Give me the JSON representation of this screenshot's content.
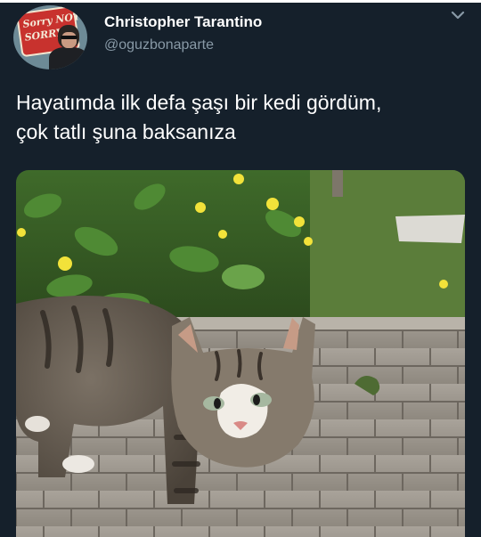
{
  "tweet": {
    "author": {
      "display_name": "Christopher Tarantino",
      "handle": "@oguzbonaparte",
      "avatar_sign_text": "Sorry NOT\nSORRY"
    },
    "text_lines": [
      "Hayatımda ilk defa şaşı bir kedi gördüm,",
      "çok tatlı şuna baksanıza"
    ],
    "media": {
      "type": "photo",
      "subject": "tabby-cat"
    }
  },
  "icons": {
    "menu": "chevron-down-icon"
  },
  "colors": {
    "background": "#15202b",
    "text_primary": "#ffffff",
    "text_secondary": "#8899a6"
  }
}
